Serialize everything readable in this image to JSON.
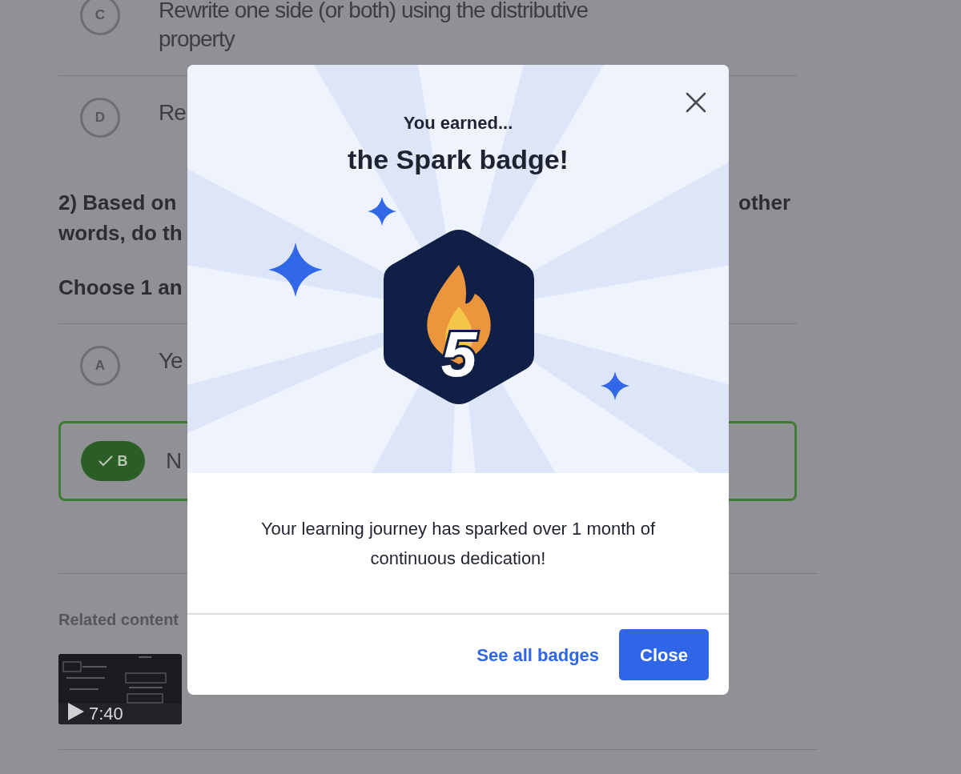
{
  "options_top": [
    {
      "letter": "C",
      "text": "Rewrite one side (or both) using the distributive property",
      "selected": false
    },
    {
      "letter": "D",
      "text": "Re",
      "selected": false
    }
  ],
  "question": {
    "line_start": "2) Based on",
    "line_end": "other",
    "line_2": "words, do th"
  },
  "instruction": "Choose 1 an",
  "options": [
    {
      "letter": "A",
      "text": "Ye",
      "selected": false
    },
    {
      "letter": "B",
      "text": "N",
      "selected": true
    }
  ],
  "related": {
    "heading": "Related content",
    "video": {
      "kind": "picture",
      "duration": "7:40"
    }
  },
  "modal": {
    "eyebrow": "You earned...",
    "title": "the Spark badge!",
    "badge_number": "5",
    "message": "Your learning journey has sparked over 1 month of continuous dedication!",
    "link": "See all badges",
    "button": "Close"
  }
}
